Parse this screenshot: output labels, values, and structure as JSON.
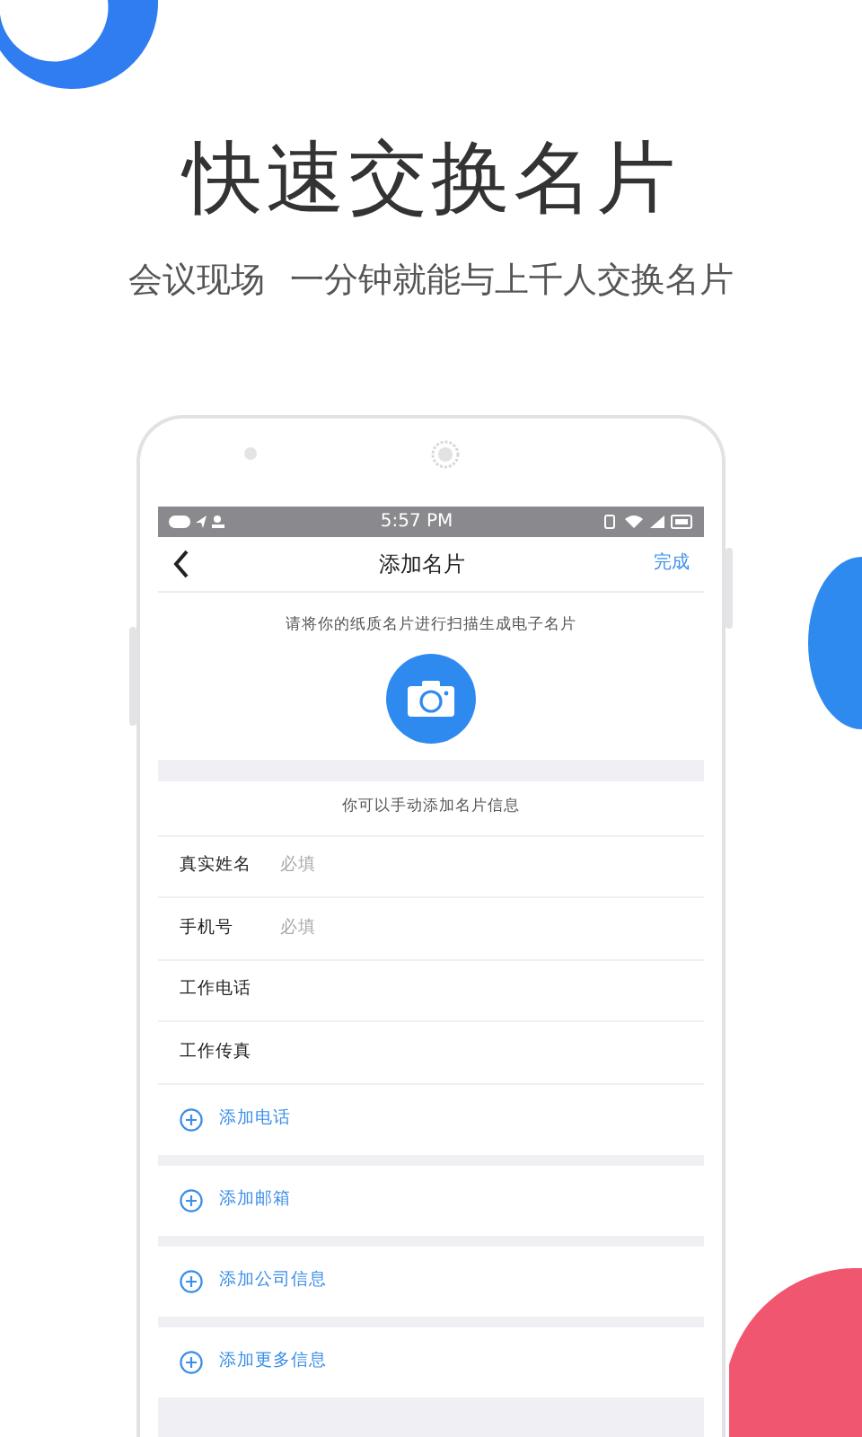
{
  "headline": "快速交换名片",
  "subtitle": [
    "会议现场",
    "一分钟就能与上千人交换名片"
  ],
  "status_bar": {
    "time": "5:57 PM"
  },
  "nav": {
    "title": "添加名片",
    "action": "完成"
  },
  "scan": {
    "hint": "请将你的纸质名片进行扫描生成电子名片"
  },
  "manual": {
    "hint": "你可以手动添加名片信息"
  },
  "fields": [
    {
      "label": "真实姓名",
      "placeholder": "必填"
    },
    {
      "label": "手机号",
      "placeholder": "必填"
    },
    {
      "label": "工作电话"
    },
    {
      "label": "工作传真"
    }
  ],
  "add_items": [
    "添加电话",
    "添加邮箱",
    "添加公司信息",
    "添加更多信息"
  ]
}
